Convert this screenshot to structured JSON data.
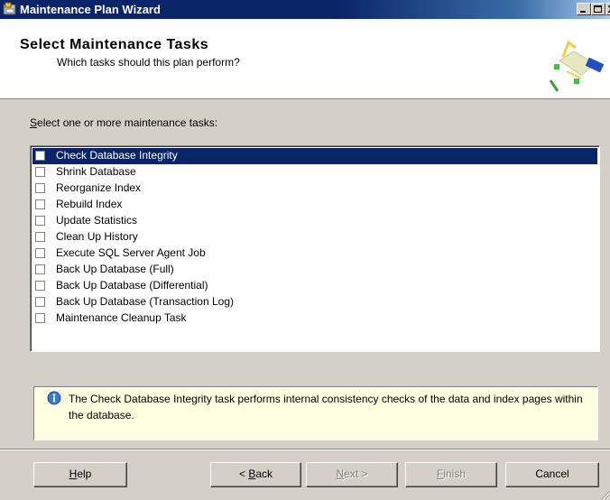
{
  "window": {
    "title": "Maintenance Plan Wizard"
  },
  "header": {
    "title": "Select Maintenance Tasks",
    "subtitle": "Which tasks should this plan perform?"
  },
  "prompt": {
    "accesskey": "S",
    "rest": "elect one or more maintenance tasks:"
  },
  "tasks": [
    {
      "label": "Check Database Integrity",
      "checked": false,
      "selected": true
    },
    {
      "label": "Shrink Database",
      "checked": false,
      "selected": false
    },
    {
      "label": "Reorganize Index",
      "checked": false,
      "selected": false
    },
    {
      "label": "Rebuild Index",
      "checked": false,
      "selected": false
    },
    {
      "label": "Update Statistics",
      "checked": false,
      "selected": false
    },
    {
      "label": "Clean Up History",
      "checked": false,
      "selected": false
    },
    {
      "label": "Execute SQL Server Agent Job",
      "checked": false,
      "selected": false
    },
    {
      "label": "Back Up Database (Full)",
      "checked": false,
      "selected": false
    },
    {
      "label": "Back Up Database (Differential)",
      "checked": false,
      "selected": false
    },
    {
      "label": "Back Up Database (Transaction Log)",
      "checked": false,
      "selected": false
    },
    {
      "label": "Maintenance Cleanup Task",
      "checked": false,
      "selected": false
    }
  ],
  "info": {
    "icon": "info-icon",
    "text": "The Check Database Integrity task performs internal consistency checks of the data and index pages within the database."
  },
  "buttons": {
    "help": {
      "accesskey": "H",
      "rest": "elp"
    },
    "back": {
      "prefix": "< ",
      "accesskey": "B",
      "rest": "ack"
    },
    "next": {
      "accesskey": "N",
      "rest": "ext >"
    },
    "finish": {
      "accesskey": "F",
      "rest": "inish"
    },
    "cancel": "Cancel"
  },
  "colors": {
    "selection": "#0a246a",
    "info_background": "#ffffe1",
    "dialog_face": "#d4d0c8"
  }
}
